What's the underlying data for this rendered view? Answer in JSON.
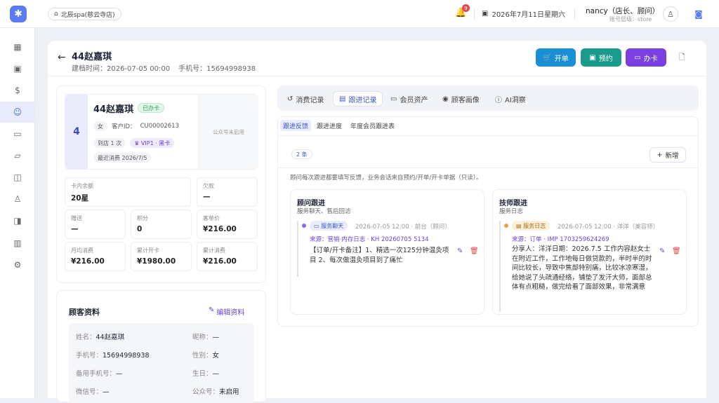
{
  "topbar": {
    "logo_glyph": "✱",
    "store": "北辰spa(慈云寺店)",
    "bell_count": "9",
    "date": "2026年7月11日星期六",
    "user_name": "nancy（店长、顾问）",
    "user_role": "账号层级：store"
  },
  "sidebar": {
    "items": [
      {
        "icon": "dashboard-icon",
        "glyph": "▦"
      },
      {
        "icon": "calendar-icon",
        "glyph": "▣"
      },
      {
        "icon": "billing-icon",
        "glyph": "$"
      },
      {
        "icon": "customers-icon",
        "glyph": "☺",
        "active": true
      },
      {
        "icon": "card-icon",
        "glyph": "▭"
      },
      {
        "icon": "folder-icon",
        "glyph": "▱"
      },
      {
        "icon": "shopping-bag-icon",
        "glyph": "◫"
      },
      {
        "icon": "staff-icon",
        "glyph": "♙"
      },
      {
        "icon": "wallet-icon",
        "glyph": "◨"
      },
      {
        "icon": "chart-icon",
        "glyph": "▥"
      },
      {
        "icon": "settings-icon",
        "glyph": "⚙"
      }
    ]
  },
  "header": {
    "name": "44赵嘉琪",
    "created": "建档时间：2026-07-05 00:00",
    "phone": "手机号：15694998938",
    "btn_open": "开单",
    "btn_book": "预约",
    "btn_card": "办卡"
  },
  "profile": {
    "number": "4",
    "name": "44赵嘉琪",
    "status": "已办卡",
    "gender": "女",
    "customer_id_label": "客户ID：",
    "customer_id": "CU00002613",
    "visits": "到店 1 次",
    "vip": "VIP1 · 黑卡",
    "last_consume": "最近消费 2026/7/5",
    "wechat_qr": "公众号未启用"
  },
  "stats": [
    {
      "label": "卡内余额",
      "value": "20星"
    },
    {
      "label": "欠款",
      "value": "—"
    },
    {
      "label": "赠送",
      "value": "—"
    },
    {
      "label": "积分",
      "value": "0"
    },
    {
      "label": "客单价",
      "value": "¥216.00"
    },
    {
      "label": "月均消费",
      "value": "¥216.00"
    },
    {
      "label": "累计开卡",
      "value": "¥1980.00"
    },
    {
      "label": "累计消费",
      "value": "¥216.00"
    }
  ],
  "customer_info": {
    "title": "顾客资料",
    "edit": "编辑资料",
    "rows": [
      {
        "label": "姓名：",
        "value": "44赵嘉琪"
      },
      {
        "label": "昵称：",
        "value": "—"
      },
      {
        "label": "手机号：",
        "value": "15694998938"
      },
      {
        "label": "性别：",
        "value": "女"
      },
      {
        "label": "备用手机号：",
        "value": "—"
      },
      {
        "label": "生日：",
        "value": "—"
      },
      {
        "label": "微信号：",
        "value": "—"
      },
      {
        "label": "公众号：",
        "value": "未启用"
      }
    ]
  },
  "tabs": [
    {
      "label": "消费记录",
      "icon": "history-icon",
      "glyph": "↺"
    },
    {
      "label": "跟进记录",
      "icon": "clipboard-icon",
      "glyph": "▤",
      "active": true
    },
    {
      "label": "会员资产",
      "icon": "card-icon",
      "glyph": "▭"
    },
    {
      "label": "顾客画像",
      "icon": "portrait-icon",
      "glyph": "◉"
    },
    {
      "label": "AI洞察",
      "icon": "ai-icon",
      "glyph": "ⓘ"
    }
  ],
  "subtabs": [
    {
      "label": "跟进反馈",
      "active": true
    },
    {
      "label": "跟进进度"
    },
    {
      "label": "年度会员跟进表"
    }
  ],
  "followup": {
    "count": "2 条",
    "add": "新增",
    "hint": "顾问每次跟进都要填写反馈，业务会话来自预约/开单/开卡单据（只读）。",
    "consultant": {
      "title": "顾问跟进",
      "subtitle": "服务聊天、售后回访",
      "tag": "服务聊天",
      "meta": "2026-07-05 12:00 · 前台（顾问）",
      "source": "来源：营销·内存日志 · KH 20260705 5134",
      "text": "【订单/开卡备注】1、精选一次125分钟温灸项目 2、每次做温灸项目到了痛忙"
    },
    "tech": {
      "title": "技师跟进",
      "subtitle": "服务日志",
      "tag": "服务日志",
      "meta": "2026-07-05 12:00 · 洋洋（美容师）",
      "source": "来源：订单 · IMP 1703259624269",
      "text": "分享人：洋洋日期：2026.7.5 工作内容赵女士在附近工作，工作地每日做贷款的，半时半的时间比较长，导致中焦部特别痛，比较冰凉寒湿，给她说了头疏通经络，铺垫了发汗大师，面部总体有点粗糙，做完给看了面部效果，非常满意"
    }
  }
}
